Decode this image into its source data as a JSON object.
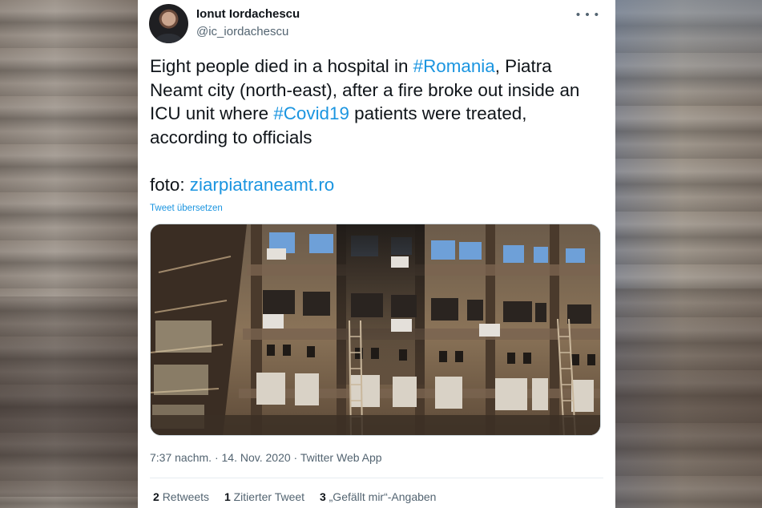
{
  "user": {
    "name": "Ionut Iordachescu",
    "handle": "@ic_iordachescu"
  },
  "tweet": {
    "text_1": "Eight people died in a hospital in ",
    "hashtag_1": "#Romania",
    "text_2": ", Piatra Neamt city (north-east), after a fire broke out inside an ICU unit where ",
    "hashtag_2": "#Covid19",
    "text_3": " patients were treated, according to officials",
    "source_label": "foto: ",
    "source_link": "ziarpiatraneamt.ro",
    "translate_label": "Tweet übersetzen",
    "more_icon": "more-horizontal-icon"
  },
  "meta": {
    "time": "7:37 nachm.",
    "sep_1": " · ",
    "date": "14. Nov. 2020",
    "sep_2": " · ",
    "client": "Twitter Web App"
  },
  "stats": {
    "retweets_count": "2",
    "retweets_label": "Retweets",
    "quotes_count": "1",
    "quotes_label": "Zitierter Tweet",
    "likes_count": "3",
    "likes_label": "„Gefällt mir“-Angaben"
  },
  "colors": {
    "link": "#1b95e0",
    "text": "#0f1419",
    "secondary": "#536471"
  }
}
